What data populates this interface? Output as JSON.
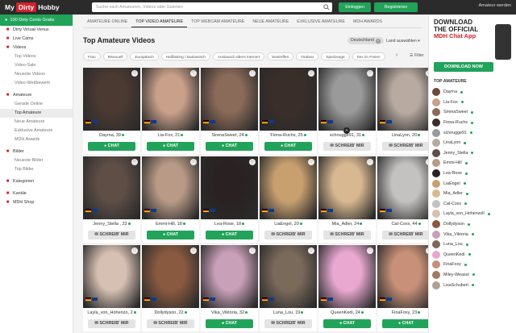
{
  "topbar": {
    "logo_my": "My",
    "logo_dirty": "Dirty",
    "logo_hobby": "Hobby",
    "search_placeholder": "Suche nach Amateuren, Videos oder Galerien",
    "login": "Einloggen",
    "register": "Registrieren",
    "become": "Amateur werden"
  },
  "sidebar": {
    "promo": "100 Dirty Cents Gratis",
    "items": [
      {
        "label": "Dirty Virtual-Venus",
        "type": "top",
        "icon": "venus-icon"
      },
      {
        "label": "Live Cams",
        "type": "top",
        "icon": "camera-icon"
      },
      {
        "label": "Videos",
        "type": "top",
        "icon": "video-icon"
      },
      {
        "label": "Top Videos",
        "type": "sub"
      },
      {
        "label": "Video-Sale",
        "type": "sub"
      },
      {
        "label": "Neueste Videos",
        "type": "sub"
      },
      {
        "label": "Video-Wettbewerb",
        "type": "sub"
      },
      {
        "label": "Amateure",
        "type": "top",
        "icon": "user-icon"
      },
      {
        "label": "Gerade Online",
        "type": "sub"
      },
      {
        "label": "Top Amateure",
        "type": "sub",
        "active": true
      },
      {
        "label": "Neue Amateure",
        "type": "sub"
      },
      {
        "label": "Exklusive Amateure",
        "type": "sub"
      },
      {
        "label": "MDH Awards",
        "type": "sub"
      },
      {
        "label": "Bilder",
        "type": "top",
        "icon": "image-icon"
      },
      {
        "label": "Neueste Bilder",
        "type": "sub"
      },
      {
        "label": "Top Bilder",
        "type": "sub"
      },
      {
        "label": "Kategorien",
        "type": "top",
        "icon": "grid-icon"
      },
      {
        "label": "Kanäle",
        "type": "top",
        "icon": "channel-icon"
      },
      {
        "label": "MDH Shop",
        "type": "top",
        "icon": "shop-icon"
      }
    ]
  },
  "tabs": [
    "AMATEURE ONLINE",
    "TOP VIDEO AMATEURE",
    "TOP WEBCAM AMATEURE",
    "NEUE AMATEURE",
    "EXKLUSIVE AMATEURE",
    "MDH AWARDS"
  ],
  "page_title": "Top Amateure Videos",
  "country_chip": "Deutschland",
  "country_select": "Land auswählen",
  "filters": [
    "Frau",
    "Bisexuell",
    "Europäisch",
    "Heilfasting / kaukasisch",
    "Austausch übers Internet",
    "Sextreffen",
    "Oralsex",
    "Spielzeuge",
    "Sex im Freien"
  ],
  "filter_button": "Filter",
  "cards": [
    {
      "name": "Dayrna, 39",
      "action": "CHAT",
      "badge": "",
      "color": "#4a3a32"
    },
    {
      "name": "Lia-Fox, 21",
      "action": "CHAT",
      "badge": "",
      "color": "#c9a08a"
    },
    {
      "name": "SirenaSweet, 24",
      "action": "CHAT",
      "badge": "",
      "color": "#8a6a58"
    },
    {
      "name": "Fiona-Ruchs, 25",
      "action": "CHAT",
      "badge": "",
      "color": "#3a2e2a"
    },
    {
      "name": "schnugge91, 31",
      "action": "SCHREIB' MIR",
      "badge": "A",
      "color": "#9a9a9a"
    },
    {
      "name": "LinaLynn, 20",
      "action": "SCHREIB' MIR",
      "badge": "",
      "color": "#b8aaa0"
    },
    {
      "name": "Jenny_Stella , 23",
      "action": "SCHREIB' MIR",
      "badge": "",
      "color": "#5e4e46"
    },
    {
      "name": "Emmi-Hill, 18",
      "action": "CHAT",
      "badge": "",
      "color": "#b89a86"
    },
    {
      "name": "Lea-Rose, 18",
      "action": "CHAT",
      "badge": "",
      "color": "#2a2222"
    },
    {
      "name": "LiaEngel, 20",
      "action": "SCHREIB' MIR",
      "badge": "",
      "color": "#c8a070"
    },
    {
      "name": "Mia_Adler, 24",
      "action": "SCHREIB' MIR",
      "badge": "",
      "color": "#d8b890"
    },
    {
      "name": "Cat-Coxx, 44",
      "action": "SCHREIB' MIR",
      "badge": "",
      "color": "#c4c2c0"
    },
    {
      "name": "Layla_von_Hohenzo, 2",
      "action": "SCHREIB' MIR",
      "badge": "",
      "color": "#d6c0b2"
    },
    {
      "name": "Dollydyson, 22",
      "action": "SCHREIB' MIR",
      "badge": "",
      "color": "#8a5a40"
    },
    {
      "name": "Vika_Viktoria, 32",
      "action": "CHAT",
      "badge": "",
      "color": "#c8a0b8"
    },
    {
      "name": "Luna_Lou, 19",
      "action": "SCHREIB' MIR",
      "badge": "",
      "color": "#7a6a5a"
    },
    {
      "name": "QueenKedi, 24",
      "action": "CHAT",
      "badge": "",
      "color": "#e8a8d0"
    },
    {
      "name": "FinaFoxy, 23",
      "action": "CHAT",
      "badge": "",
      "color": "#c89078"
    }
  ],
  "right": {
    "ad_line1": "DOWNLOAD",
    "ad_line2": "THE OFFICIAL",
    "ad_line3": "MDH Chat App",
    "ad_button": "DOWNLOAD NOW",
    "list_title": "TOP AMATEURE",
    "list": [
      "Dayrna",
      "Lia-Fox",
      "SirenaSweet",
      "Fiona-Ruchs",
      "schnugge91",
      "LinaLynn",
      "Jenny_Stella",
      "Emmi-Hill",
      "Lea-Rose",
      "LiaEngel",
      "Mia_Adler",
      "Cat-Coxx",
      "Layla_von_Hohenzoll",
      "Dollydyson",
      "Vika_Viktoria",
      "Luna_Lou",
      "QueenKedi",
      "FinaFoxy",
      "Miley-Weasel",
      "LisaSchubert"
    ]
  }
}
